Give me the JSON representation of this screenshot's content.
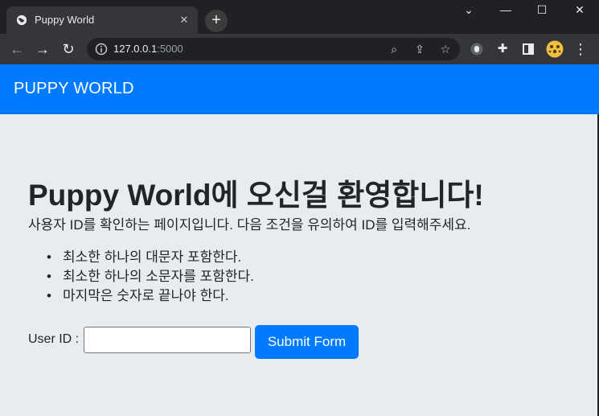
{
  "browser": {
    "tab_title": "Puppy World",
    "url_host": "127.0.0.1",
    "url_port": ":5000",
    "icons": [
      "globe-icon",
      "close-icon",
      "plus-icon",
      "chevron-down-icon",
      "minimize-icon",
      "maximize-icon",
      "close-window-icon",
      "back-arrow-icon",
      "forward-arrow-icon",
      "reload-icon",
      "info-icon",
      "zoom-icon",
      "share-icon",
      "star-icon",
      "extension-icon",
      "puzzle-icon",
      "sidepanel-icon",
      "profile-avatar",
      "kebab-menu-icon"
    ]
  },
  "navbar": {
    "brand": "PUPPY WORLD"
  },
  "main": {
    "title_bold": "Puppy World",
    "title_rest": "에 오신걸 환영합니다",
    "title_bang": "!",
    "lead": "사용자 ID를 확인하는 페이지입니다. 다음 조건을 유의하여 ID를 입력해주세요.",
    "rules": [
      "최소한 하나의 대문자 포함한다.",
      "최소한 하나의 소문자를 포함한다.",
      "마지막은 숫자로 끝나야 한다."
    ],
    "form": {
      "label": "User ID :",
      "input_value": "",
      "submit_label": "Submit Form"
    }
  },
  "colors": {
    "primary": "#007bff",
    "page_bg": "#e9ecef",
    "chrome_dark": "#202124",
    "chrome_tab": "#35363a"
  }
}
